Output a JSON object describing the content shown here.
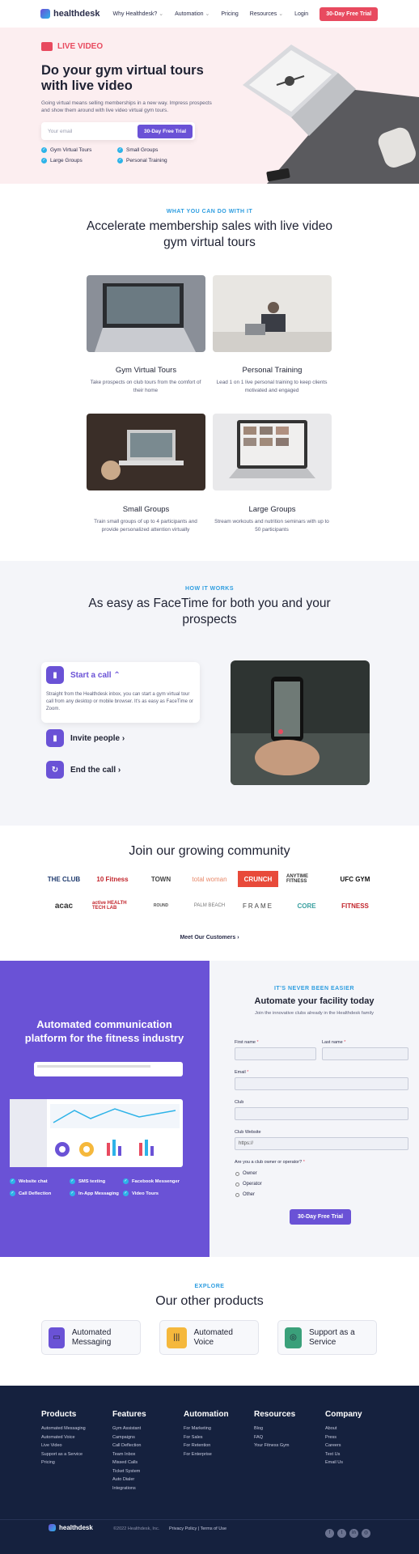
{
  "nav": {
    "logo": "healthdesk",
    "links": [
      "Why Healthdesk?",
      "Automation",
      "Pricing",
      "Resources",
      "Login"
    ],
    "cta": "30-Day Free Trial"
  },
  "hero": {
    "badge": "LIVE VIDEO",
    "title": "Do your gym virtual tours with live video",
    "subtitle": "Going virtual means selling memberships in a new way. Impress prospects and show them around with live video virtual gym tours.",
    "email_placeholder": "Your email",
    "cta": "30-Day Free Trial",
    "checks": [
      "Gym Virtual Tours",
      "Small Groups",
      "Large Groups",
      "Personal Training"
    ]
  },
  "features": {
    "eyebrow": "WHAT YOU CAN DO WITH IT",
    "title": "Accelerate membership sales with live video gym virtual tours",
    "cards": [
      {
        "title": "Gym Virtual Tours",
        "desc": "Take prospects on club tours from the comfort of their home"
      },
      {
        "title": "Personal Training",
        "desc": "Lead 1 on 1 live personal training to keep clients motivated and engaged"
      },
      {
        "title": "Small Groups",
        "desc": "Train small groups of up to 4 participants and provide personalized attention virtually"
      },
      {
        "title": "Large Groups",
        "desc": "Stream workouts and nutrition seminars with up to 50 participants"
      }
    ]
  },
  "how": {
    "eyebrow": "HOW IT WORKS",
    "title": "As easy as FaceTime for both you and your prospects",
    "steps": [
      {
        "label": "Start a call ⌃",
        "desc": "Straight from the Healthdesk inbox, you can start a gym virtual tour call from any desktop or mobile browser. It's as easy as FaceTime or Zoom."
      },
      {
        "label": "Invite people ›"
      },
      {
        "label": "End the call ›"
      }
    ]
  },
  "community": {
    "title": "Join our growing community",
    "logos_row1": [
      "THE CLUB",
      "10 Fitness",
      "TOWN",
      "total woman",
      "CRUNCH",
      "ANYTIME FITNESS",
      "UFC GYM"
    ],
    "logos_row2": [
      "acac",
      "active HEALTH TECH LAB",
      "ROUND",
      "PALM BEACH",
      "FRAME",
      "CORE",
      "FITNESS"
    ],
    "link": "Meet Our Customers ›"
  },
  "signup": {
    "left_title": "Automated communication platform for the fitness industry",
    "tags": [
      "Website chat",
      "SMS texting",
      "Facebook Messenger",
      "Call Deflection",
      "In-App Messaging",
      "Video Tours"
    ],
    "eyebrow": "IT'S NEVER BEEN EASIER",
    "title": "Automate your facility today",
    "subtitle": "Join the innovative clubs already in the Healthdesk family",
    "labels": {
      "first": "First name",
      "last": "Last name",
      "email": "Email",
      "club": "Club",
      "website": "Club Website",
      "owner_q": "Are you a club owner or operator?"
    },
    "website_value": "https://",
    "options": [
      "Owner",
      "Operator",
      "Other"
    ],
    "cta": "30-Day Free Trial"
  },
  "products": {
    "eyebrow": "EXPLORE",
    "title": "Our other products",
    "items": [
      "Automated Messaging",
      "Automated Voice",
      "Support as a Service"
    ]
  },
  "footer": {
    "columns": [
      {
        "title": "Products",
        "links": [
          "Automated Messaging",
          "Automated Voice",
          "Live Video",
          "Support as a Service",
          "Pricing"
        ]
      },
      {
        "title": "Features",
        "links": [
          "Gym Assistant",
          "Campaigns",
          "Call Deflection",
          "Team Inbox",
          "Missed Calls",
          "Ticket System",
          "Auto Dialer",
          "Integrations"
        ]
      },
      {
        "title": "Automation",
        "links": [
          "For Marketing",
          "For Sales",
          "For Retention",
          "For Enterprise"
        ]
      },
      {
        "title": "Resources",
        "links": [
          "Blog",
          "FAQ",
          "Your Fitness Gym"
        ]
      },
      {
        "title": "Company",
        "links": [
          "About",
          "Press",
          "Careers",
          "Text Us",
          "Email Us"
        ]
      }
    ],
    "logo": "healthdesk",
    "copyright": "©2022 Healthdesk, Inc.",
    "legal": "Privacy Policy | Terms of Use"
  },
  "colors": {
    "accent": "#6a52d6",
    "red": "#e84a5f",
    "blue": "#2db3e8",
    "navy": "#15213e",
    "hero_bg": "#fceef0"
  }
}
